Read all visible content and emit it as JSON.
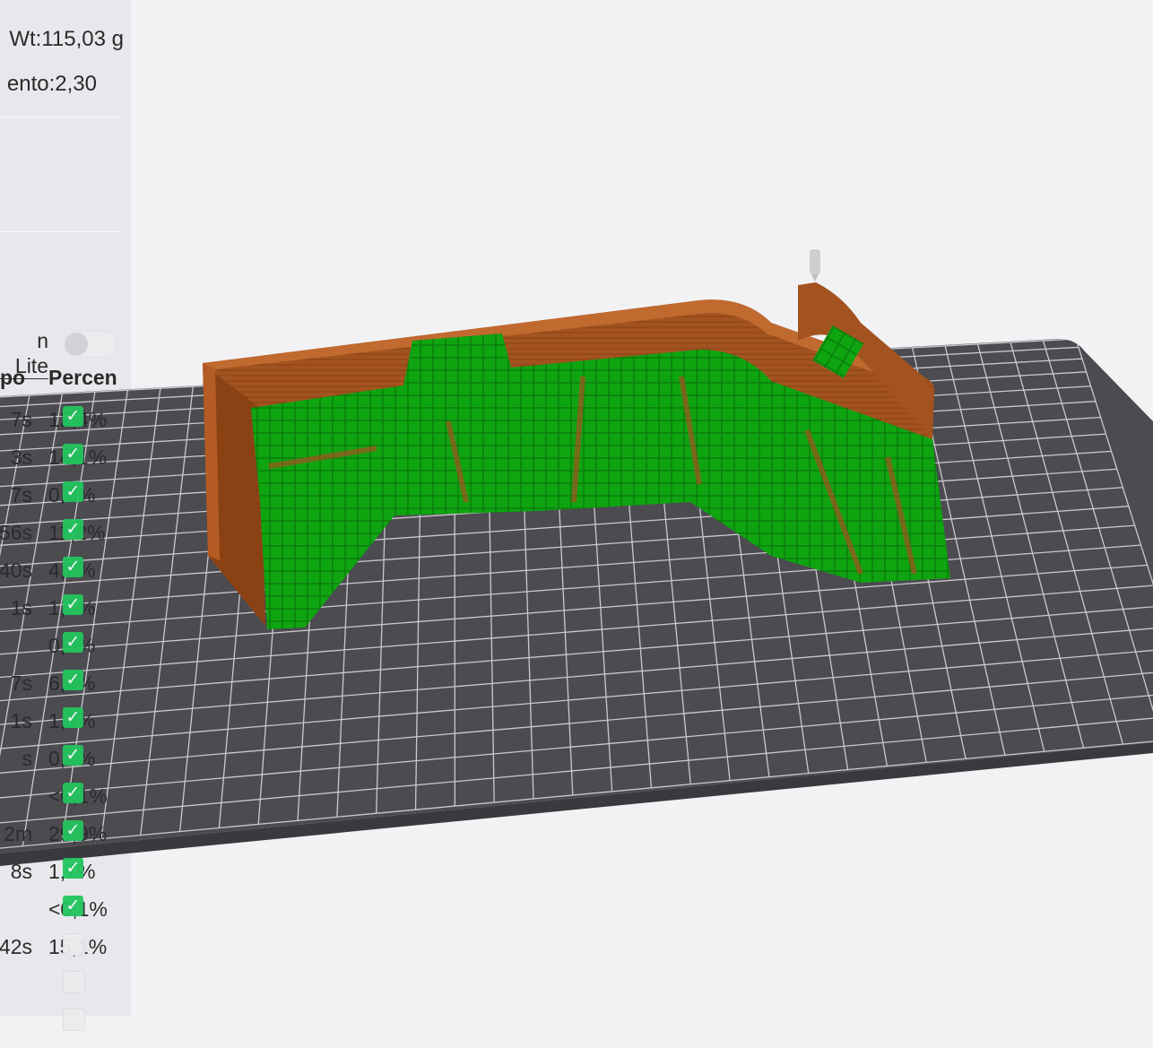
{
  "stats": {
    "weight": "Wt:115,03 g",
    "cost": "ento:2,30"
  },
  "lite_label": "n Lite",
  "lite_toggle_on": false,
  "table": {
    "headers": [
      "po",
      "Percen"
    ],
    "rows": [
      {
        "time": "7s",
        "percent": "12,4%",
        "checked": true
      },
      {
        "time": "3s",
        "percent": "14,1%",
        "checked": true
      },
      {
        "time": "7s",
        "percent": "0,6%",
        "checked": true
      },
      {
        "time": "56s",
        "percent": "11,2%",
        "checked": true
      },
      {
        "time": "40s",
        "percent": "4,6%",
        "checked": true
      },
      {
        "time": "1s",
        "percent": "1,2%",
        "checked": true
      },
      {
        "time": "",
        "percent": "0,3%",
        "checked": true
      },
      {
        "time": "7s",
        "percent": "6,6%",
        "checked": true
      },
      {
        "time": "1s",
        "percent": "1,2%",
        "checked": true
      },
      {
        "time": "s",
        "percent": "0,4%",
        "checked": true
      },
      {
        "time": "",
        "percent": "<0,1%",
        "checked": true
      },
      {
        "time": "2m",
        "percent": "29,9%",
        "checked": true
      },
      {
        "time": "8s",
        "percent": "1,7%",
        "checked": true
      },
      {
        "time": "",
        "percent": "<0,1%",
        "checked": true
      },
      {
        "time": "42s",
        "percent": "15,1%",
        "checked": false
      },
      {
        "time": "",
        "percent": "",
        "checked": false
      },
      {
        "time": "",
        "percent": "",
        "checked": false
      }
    ]
  },
  "colors": {
    "bed": "#4b4b50",
    "grid": "#d8d8dc",
    "wall": "#a0501f",
    "support": "#0ea510",
    "check": "#22c55e"
  }
}
